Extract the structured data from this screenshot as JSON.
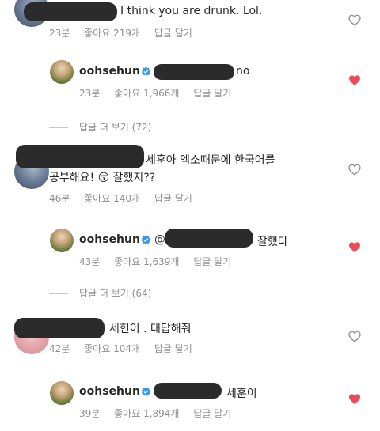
{
  "comments": [
    {
      "text": "I think you are drunk. Lol.",
      "time": "23분",
      "likes": "좋아요 219개",
      "reply": "답글 달기",
      "liked": false
    },
    {
      "username": "oohsehun",
      "text": "no",
      "time": "23분",
      "likes": "좋아요 1,966개",
      "reply": "답글 달기",
      "liked": true
    },
    {
      "view_replies": "답글 더 보기 (72)"
    },
    {
      "text_line1": "세훈아 엑소때문에 한국어를",
      "text_line2_a": "공부해요!",
      "emoji": "😚",
      "text_line2_b": "잘했지??",
      "time": "46분",
      "likes": "좋아요 140개",
      "reply": "답글 달기",
      "liked": false
    },
    {
      "username": "oohsehun",
      "mention_prefix": "@",
      "text": "잘했다",
      "time": "43분",
      "likes": "좋아요 1,639개",
      "reply": "답글 달기",
      "liked": true
    },
    {
      "view_replies": "답글 더 보기 (64)"
    },
    {
      "text": "세헌이 . 대답해줘",
      "time": "42분",
      "likes": "좋아요 104개",
      "reply": "답글 달기",
      "liked": false
    },
    {
      "username": "oohsehun",
      "text": "세훈이",
      "time": "39분",
      "likes": "좋아요 1,894개",
      "reply": "답글 달기",
      "liked": true
    }
  ],
  "colors": {
    "heart_liked": "#ed4956",
    "heart_outline": "#8e8e8e",
    "verified": "#3897f0",
    "meta_text": "#8e8e8e"
  }
}
